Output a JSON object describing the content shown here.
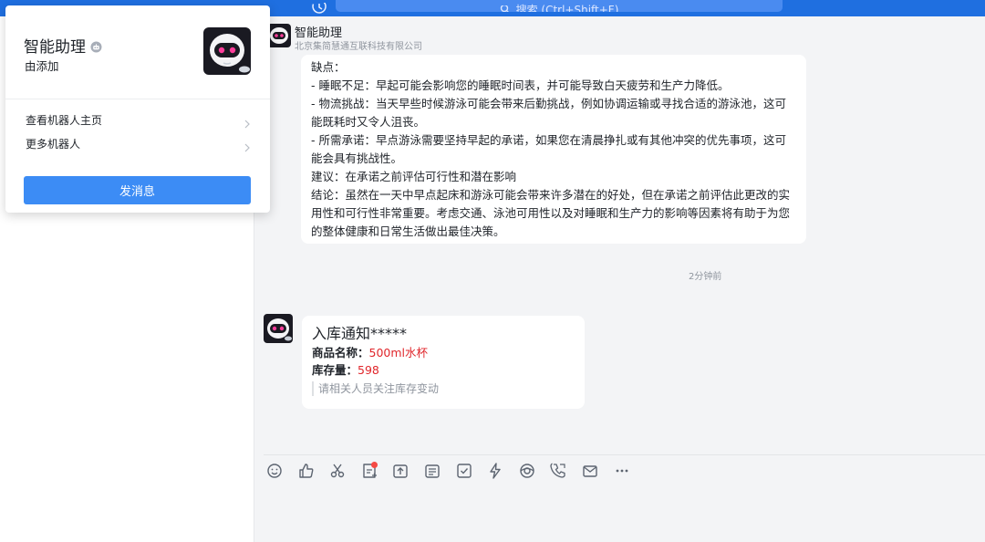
{
  "colors": {
    "topbar": "#1f6fe0",
    "accent_button": "#3c8cf5",
    "value_red": "#e0262b",
    "badge_red": "#f54a45"
  },
  "topbar": {
    "search_placeholder": "搜索 (Ctrl+Shift+F)"
  },
  "popup": {
    "name": "智能助理",
    "added_by": "由添加",
    "menu": [
      {
        "label": "查看机器人主页"
      },
      {
        "label": "更多机器人"
      }
    ],
    "send_button": "发消息"
  },
  "chat": {
    "title": "智能助理",
    "subtitle": "北京集简慧通互联科技有限公司",
    "message1": {
      "lines": [
        "缺点：",
        "- 睡眠不足：早起可能会影响您的睡眠时间表，并可能导致白天疲劳和生产力降低。",
        "- 物流挑战：当天早些时候游泳可能会带来后勤挑战，例如协调运输或寻找合适的游泳池，这可能既耗时又令人沮丧。",
        "- 所需承诺：早点游泳需要坚持早起的承诺，如果您在清晨挣扎或有其他冲突的优先事项，这可能会具有挑战性。",
        "建议：在承诺之前评估可行性和潜在影响",
        "结论：虽然在一天中早点起床和游泳可能会带来许多潜在的好处，但在承诺之前评估此更改的实用性和可行性非常重要。考虑交通、泳池可用性以及对睡眠和生产力的影响等因素将有助于为您的整体健康和日常生活做出最佳决策。"
      ]
    },
    "timestamp": "2分钟前",
    "card": {
      "title": "入库通知*****",
      "product_label": "商品名称：",
      "product_value": "500ml水杯",
      "stock_label": "库存量：",
      "stock_value": "598",
      "note": "请相关人员关注库存变动"
    }
  },
  "toolbar": {
    "icons": [
      "emoji-icon",
      "thumbs-up-icon",
      "scissors-icon",
      "doc-plus-icon",
      "upload-icon",
      "calendar-icon",
      "checkbox-icon",
      "lightning-icon",
      "ai-icon",
      "phone-icon",
      "mail-icon",
      "more-icon"
    ]
  }
}
